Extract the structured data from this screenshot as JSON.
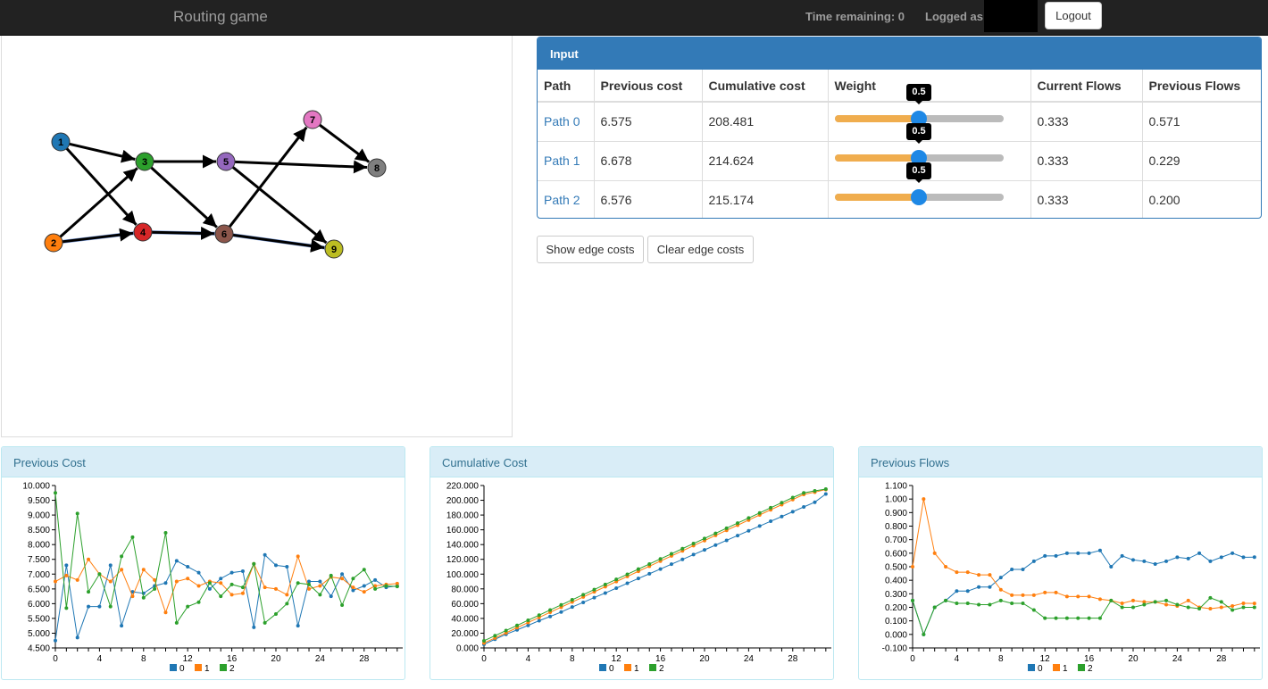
{
  "app": {
    "brand": "Routing game",
    "time_remaining": "Time remaining: 0",
    "logged_as": "Logged as:",
    "logout": "Logout"
  },
  "graph": {
    "nodes": [
      {
        "id": "1",
        "color": "#1f77b4"
      },
      {
        "id": "2",
        "color": "#ff7f0e"
      },
      {
        "id": "3",
        "color": "#2ca02c"
      },
      {
        "id": "4",
        "color": "#d62728"
      },
      {
        "id": "5",
        "color": "#9467bd"
      },
      {
        "id": "6",
        "color": "#8c564b"
      },
      {
        "id": "7",
        "color": "#e377c2"
      },
      {
        "id": "8",
        "color": "#7f7f7f"
      },
      {
        "id": "9",
        "color": "#bcbd22"
      }
    ],
    "edges": [
      {
        "from": "1",
        "to": "3"
      },
      {
        "from": "1",
        "to": "4"
      },
      {
        "from": "2",
        "to": "3"
      },
      {
        "from": "2",
        "to": "4"
      },
      {
        "from": "3",
        "to": "5"
      },
      {
        "from": "3",
        "to": "6"
      },
      {
        "from": "4",
        "to": "6"
      },
      {
        "from": "5",
        "to": "8"
      },
      {
        "from": "5",
        "to": "9"
      },
      {
        "from": "6",
        "to": "7"
      },
      {
        "from": "6",
        "to": "9"
      },
      {
        "from": "7",
        "to": "8"
      }
    ],
    "highlighted_path": [
      "2",
      "4",
      "6",
      "9"
    ],
    "highlight_color": "#7b9ee0"
  },
  "input": {
    "heading": "Input",
    "columns": [
      "Path",
      "Previous cost",
      "Cumulative cost",
      "Weight",
      "Current Flows",
      "Previous Flows"
    ],
    "rows": [
      {
        "path": "Path 0",
        "prev_cost": "6.575",
        "cum_cost": "208.481",
        "weight": 0.5,
        "weight_label": "0.5",
        "cur_flow": "0.333",
        "prev_flow": "0.571"
      },
      {
        "path": "Path 1",
        "prev_cost": "6.678",
        "cum_cost": "214.624",
        "weight": 0.5,
        "weight_label": "0.5",
        "cur_flow": "0.333",
        "prev_flow": "0.229"
      },
      {
        "path": "Path 2",
        "prev_cost": "6.576",
        "cum_cost": "215.174",
        "weight": 0.5,
        "weight_label": "0.5",
        "cur_flow": "0.333",
        "prev_flow": "0.200"
      }
    ]
  },
  "buttons": {
    "show_edge_costs": "Show edge costs",
    "clear_edge_costs": "Clear edge costs"
  },
  "colors": {
    "series_0": "#1f77b4",
    "series_1": "#ff7f0e",
    "series_2": "#2ca02c",
    "panel_primary": "#337ab7"
  },
  "chart_data": [
    {
      "type": "line",
      "title": "Previous Cost",
      "xlabel": "",
      "ylabel": "",
      "x": [
        0,
        1,
        2,
        3,
        4,
        5,
        6,
        7,
        8,
        9,
        10,
        11,
        12,
        13,
        14,
        15,
        16,
        17,
        18,
        19,
        20,
        21,
        22,
        23,
        24,
        25,
        26,
        27,
        28,
        29,
        30,
        31
      ],
      "xticks": [
        0,
        4,
        8,
        12,
        16,
        20,
        24,
        28
      ],
      "ylim": [
        4.5,
        10.0
      ],
      "yticks": [
        4.5,
        5.0,
        5.5,
        6.0,
        6.5,
        7.0,
        7.5,
        8.0,
        8.5,
        9.0,
        9.5,
        10.0
      ],
      "ytick_labels": [
        "4.500",
        "5.000",
        "5.500",
        "6.000",
        "6.500",
        "7.000",
        "7.500",
        "8.000",
        "8.500",
        "9.000",
        "9.500",
        "10.000"
      ],
      "legend": "bottom",
      "series": [
        {
          "name": "0",
          "values": [
            4.75,
            7.3,
            4.85,
            5.9,
            5.9,
            7.3,
            5.25,
            6.4,
            6.35,
            6.6,
            6.7,
            7.45,
            7.25,
            7.05,
            6.5,
            6.85,
            7.05,
            7.1,
            5.2,
            7.65,
            7.3,
            7.25,
            5.25,
            6.75,
            6.75,
            6.25,
            7.0,
            6.45,
            6.6,
            6.8,
            6.55,
            6.6
          ]
        },
        {
          "name": "1",
          "values": [
            6.75,
            6.95,
            6.8,
            7.5,
            7.0,
            6.75,
            7.15,
            6.25,
            7.15,
            6.8,
            5.7,
            6.75,
            6.85,
            6.6,
            6.75,
            6.7,
            6.3,
            6.35,
            7.35,
            6.55,
            6.5,
            6.3,
            7.6,
            6.5,
            6.6,
            6.9,
            6.85,
            6.55,
            6.4,
            6.6,
            6.65,
            6.68
          ]
        },
        {
          "name": "2",
          "values": [
            9.75,
            5.85,
            9.05,
            6.4,
            7.0,
            5.9,
            7.6,
            8.25,
            6.2,
            6.5,
            8.4,
            5.35,
            5.9,
            6.05,
            6.7,
            6.25,
            6.65,
            6.55,
            7.35,
            5.35,
            5.65,
            6.0,
            6.7,
            6.65,
            6.3,
            6.95,
            5.95,
            6.85,
            7.15,
            6.5,
            6.6,
            6.58
          ]
        }
      ]
    },
    {
      "type": "line",
      "title": "Cumulative Cost",
      "xlabel": "",
      "ylabel": "",
      "x": [
        0,
        1,
        2,
        3,
        4,
        5,
        6,
        7,
        8,
        9,
        10,
        11,
        12,
        13,
        14,
        15,
        16,
        17,
        18,
        19,
        20,
        21,
        22,
        23,
        24,
        25,
        26,
        27,
        28,
        29,
        30,
        31
      ],
      "xticks": [
        0,
        4,
        8,
        12,
        16,
        20,
        24,
        28
      ],
      "ylim": [
        0,
        220
      ],
      "yticks": [
        0,
        20,
        40,
        60,
        80,
        100,
        120,
        140,
        160,
        180,
        200,
        220
      ],
      "ytick_labels": [
        "0.000",
        "20.000",
        "40.000",
        "60.000",
        "80.000",
        "100.000",
        "120.000",
        "140.000",
        "160.000",
        "180.000",
        "200.000",
        "220.000"
      ],
      "legend": "bottom",
      "series": [
        {
          "name": "0",
          "values": [
            4.8,
            11.8,
            18.5,
            24.5,
            30.5,
            36.9,
            42.6,
            48.6,
            55.4,
            61.7,
            68.2,
            74.4,
            81.0,
            87.6,
            94.1,
            100.5,
            106.9,
            113.4,
            119.9,
            126.4,
            132.8,
            139.3,
            145.7,
            152.2,
            158.7,
            165.1,
            171.6,
            178.0,
            184.5,
            191.0,
            197.4,
            208.5
          ]
        },
        {
          "name": "1",
          "values": [
            6.7,
            13.5,
            20.4,
            27.5,
            34.4,
            41.3,
            48.3,
            55.2,
            62.2,
            69.0,
            76.0,
            82.9,
            89.9,
            96.8,
            103.8,
            110.7,
            117.6,
            124.6,
            131.5,
            138.5,
            145.4,
            152.4,
            159.3,
            166.2,
            173.2,
            180.1,
            187.1,
            194.0,
            200.9,
            207.9,
            211.0,
            214.6
          ]
        },
        {
          "name": "2",
          "values": [
            9.7,
            16.6,
            23.6,
            30.5,
            37.5,
            44.4,
            51.4,
            58.3,
            65.2,
            72.1,
            79.1,
            86.0,
            92.9,
            99.8,
            106.8,
            113.7,
            120.6,
            127.5,
            134.5,
            141.4,
            148.3,
            155.2,
            162.2,
            169.1,
            176.0,
            182.9,
            189.9,
            196.8,
            203.7,
            210.0,
            212.8,
            215.2
          ]
        }
      ]
    },
    {
      "type": "line",
      "title": "Previous Flows",
      "xlabel": "",
      "ylabel": "",
      "x": [
        0,
        1,
        2,
        3,
        4,
        5,
        6,
        7,
        8,
        9,
        10,
        11,
        12,
        13,
        14,
        15,
        16,
        17,
        18,
        19,
        20,
        21,
        22,
        23,
        24,
        25,
        26,
        27,
        28,
        29,
        30,
        31
      ],
      "xticks": [
        0,
        4,
        8,
        12,
        16,
        20,
        24,
        28
      ],
      "ylim": [
        -0.1,
        1.1
      ],
      "yticks": [
        -0.1,
        0.0,
        0.1,
        0.2,
        0.3,
        0.4,
        0.5,
        0.6,
        0.7,
        0.8,
        0.9,
        1.0,
        1.1
      ],
      "ytick_labels": [
        "-0.100",
        "0.000",
        "0.100",
        "0.200",
        "0.300",
        "0.400",
        "0.500",
        "0.600",
        "0.700",
        "0.800",
        "0.900",
        "1.000",
        "1.100"
      ],
      "legend": "bottom",
      "series": [
        {
          "name": "0",
          "values": [
            0.25,
            0.0,
            0.2,
            0.25,
            0.32,
            0.32,
            0.35,
            0.35,
            0.42,
            0.48,
            0.48,
            0.54,
            0.58,
            0.58,
            0.6,
            0.6,
            0.6,
            0.62,
            0.5,
            0.58,
            0.55,
            0.54,
            0.52,
            0.54,
            0.57,
            0.56,
            0.6,
            0.54,
            0.57,
            0.6,
            0.57,
            0.571
          ]
        },
        {
          "name": "1",
          "values": [
            0.5,
            1.0,
            0.6,
            0.5,
            0.46,
            0.46,
            0.44,
            0.44,
            0.33,
            0.29,
            0.29,
            0.29,
            0.31,
            0.31,
            0.28,
            0.28,
            0.28,
            0.26,
            0.25,
            0.23,
            0.25,
            0.24,
            0.24,
            0.22,
            0.21,
            0.25,
            0.2,
            0.19,
            0.2,
            0.21,
            0.23,
            0.229
          ]
        },
        {
          "name": "2",
          "values": [
            0.25,
            0.0,
            0.2,
            0.25,
            0.23,
            0.23,
            0.22,
            0.22,
            0.25,
            0.23,
            0.23,
            0.18,
            0.12,
            0.12,
            0.12,
            0.12,
            0.12,
            0.12,
            0.25,
            0.2,
            0.2,
            0.22,
            0.24,
            0.25,
            0.22,
            0.2,
            0.19,
            0.27,
            0.24,
            0.18,
            0.2,
            0.2
          ]
        }
      ]
    }
  ]
}
